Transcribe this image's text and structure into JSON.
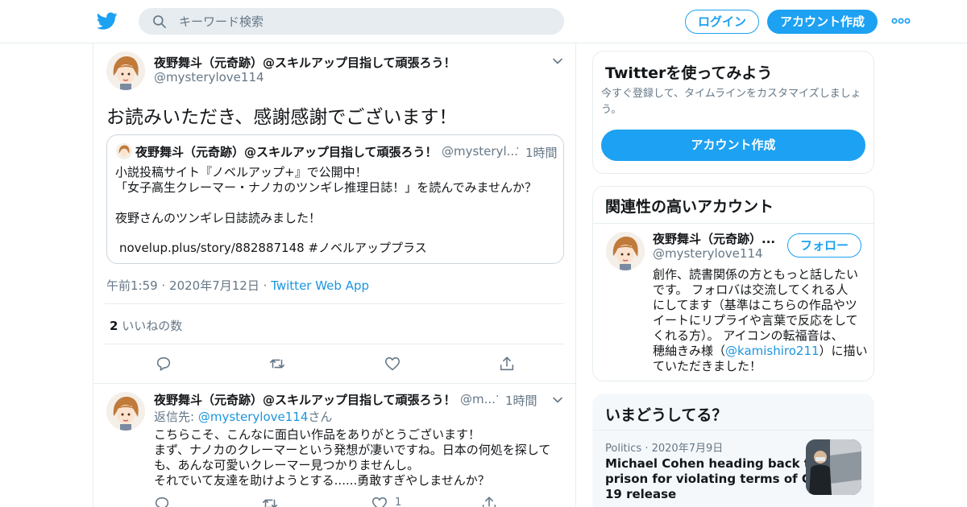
{
  "colors": {
    "accent": "#1da1f2",
    "link": "#1b95e0",
    "text": "#14171a",
    "muted": "#657786",
    "border": "#e6ecf0"
  },
  "topbar": {
    "logo_icon": "twitter-bird-icon",
    "search": {
      "placeholder": "キーワード検索",
      "icon": "search-icon"
    },
    "login_label": "ログイン",
    "signup_label": "アカウント作成",
    "more_icon": "more-icon"
  },
  "tweet": {
    "author_name": "夜野舞斗（元奇跡）@スキルアップ目指して頑張ろう！",
    "author_handle": "@mysterylove114",
    "text": "お読みいただき、感謝感謝でございます！",
    "quote": {
      "author_name": "夜野舞斗（元奇跡）@スキルアップ目指して頑張ろう！",
      "author_handle": "@mysteryl...",
      "separator": "·",
      "time": "1時間",
      "lines": [
        "小説投稿サイト『ノベルアップ+』で公開中！",
        "「女子高生クレーマー・ナノカのツンギレ推理日誌！」を読んでみませんか？",
        "夜野さんのツンギレ日誌読みました！",
        "novelup.plus/story/882887148 #ノベルアッププラス"
      ]
    },
    "meta": {
      "time": "午前1:59",
      "date": "2020年7月12日",
      "separator": "·",
      "source": "Twitter Web App"
    },
    "likes": {
      "count": "2",
      "label": "いいねの数"
    },
    "actions": [
      "reply-icon",
      "retweet-icon",
      "like-icon",
      "share-icon"
    ]
  },
  "reply": {
    "author_name": "夜野舞斗（元奇跡）@スキルアップ目指して頑張ろう！",
    "author_handle": "@m...",
    "separator": "·",
    "time": "1時間",
    "reply_to_prefix": "返信先: ",
    "reply_to_mention": "@mysterylove114",
    "reply_to_suffix": "さん",
    "lines": [
      "こちらこそ、こんなに面白い作品をありがとうございます！",
      "まず、ナノカのクレーマーという発想が凄いですね。日本の何処を探して",
      "も、あんな可愛いクレーマー見つかりませんし。",
      "それでいて友達を助けようとする......勇敢すぎやしませんか？"
    ],
    "like_count": "1"
  },
  "sidebar": {
    "signup_card": {
      "title": "Twitterを使ってみよう",
      "description": "今すぐ登録して、タイムラインをカスタマイズしましょう。",
      "button": "アカウント作成"
    },
    "related_card": {
      "title": "関連性の高いアカウント",
      "name": "夜野舞斗（元奇跡）...",
      "handle": "@mysterylove114",
      "follow_label": "フォロー",
      "bio_lines": [
        "創作、読書関係の方ともっと話したい",
        "です。 フォロバは交流してくれる人",
        "にしてます（基準はこちらの作品やツ",
        "イートにリプライや言葉で反応をして",
        "くれる方）。 アイコンの転福音は、"
      ],
      "bio_line6_prefix": "穂紬きみ様（",
      "bio_line6_mention": "@kamishiro211",
      "bio_line6_suffix": "）に描い",
      "bio_line7": "ていただきました！"
    },
    "trends_card": {
      "title": "いまどうしてる？",
      "category": "Politics",
      "separator": "·",
      "date": "2020年7月9日",
      "headline_lines": [
        "Michael Cohen heading back to",
        "prison for violating terms of COVID-",
        "19 release"
      ]
    }
  }
}
